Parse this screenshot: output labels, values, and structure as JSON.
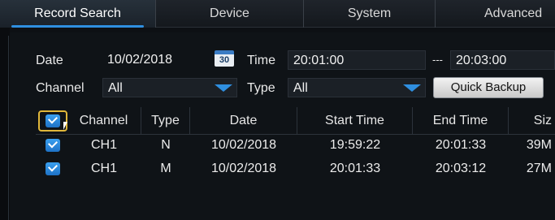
{
  "tabs": [
    {
      "label": "Record Search",
      "active": true
    },
    {
      "label": "Device"
    },
    {
      "label": "System"
    },
    {
      "label": "Advanced"
    }
  ],
  "search": {
    "date_label": "Date",
    "date_value": "10/02/2018",
    "calendar_icon_text": "30",
    "time_label": "Time",
    "start_time": "20:01:00",
    "time_separator": "---",
    "end_time": "20:03:00",
    "channel_label": "Channel",
    "channel_value": "All",
    "type_label": "Type",
    "type_value": "All",
    "quick_backup_label": "Quick Backup"
  },
  "table": {
    "columns": [
      "Channel",
      "Type",
      "Date",
      "Start Time",
      "End Time",
      "Siz"
    ],
    "rows": [
      {
        "channel": "CH1",
        "type": "N",
        "date": "10/02/2018",
        "start": "19:59:22",
        "end": "20:01:33",
        "size": "39M"
      },
      {
        "channel": "CH1",
        "type": "M",
        "date": "10/02/2018",
        "start": "20:01:33",
        "end": "20:03:12",
        "size": "27M"
      }
    ]
  },
  "colors": {
    "accent": "#2f8fe0",
    "checkbox_highlight": "#e0b73a"
  }
}
